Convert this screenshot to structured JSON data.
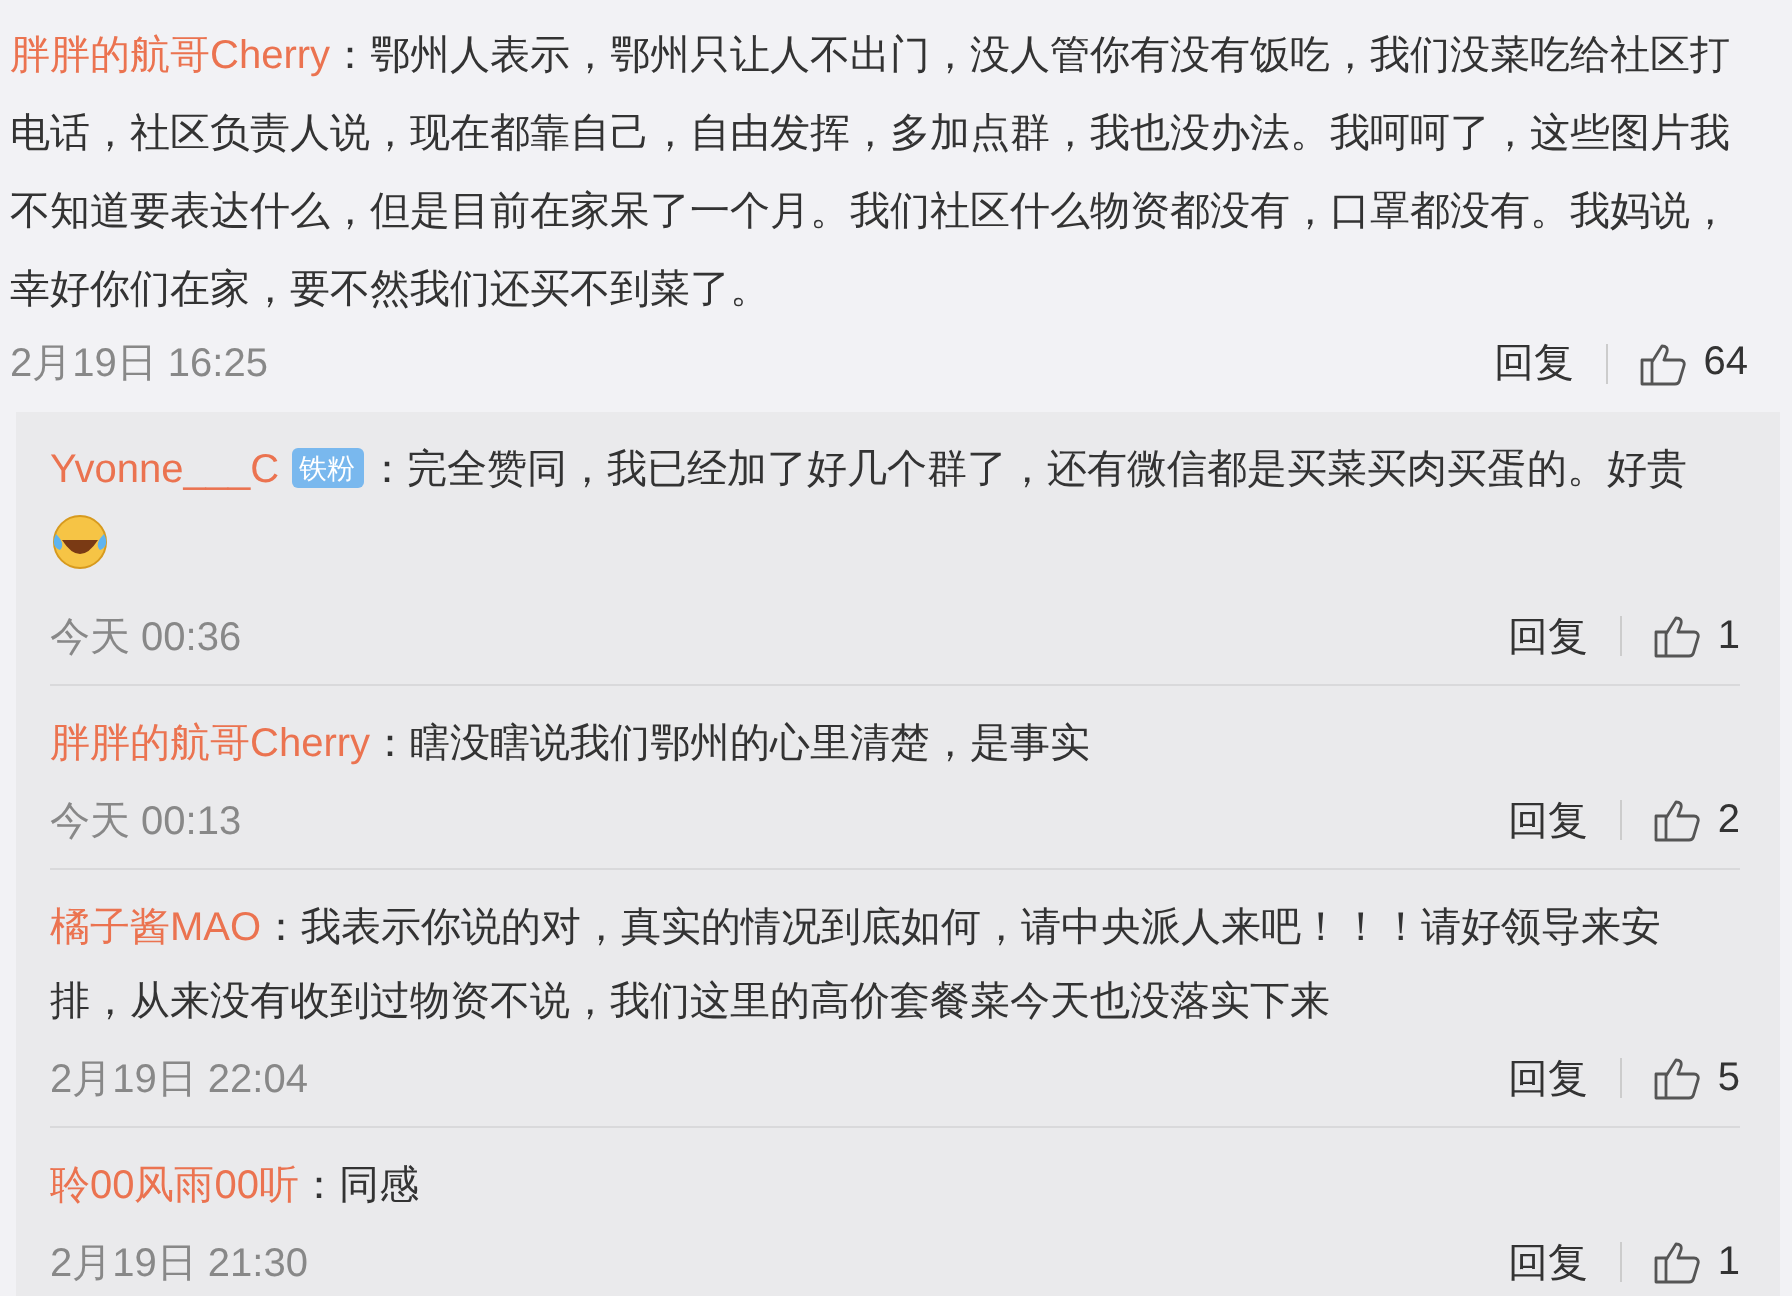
{
  "comment": {
    "author": "胖胖的航哥Cherry",
    "separator": "：",
    "text": "鄂州人表示，鄂州只让人不出门，没人管你有没有饭吃，我们没菜吃给社区打电话，社区负责人说，现在都靠自己，自由发挥，多加点群，我也没办法。我呵呵了，这些图片我不知道要表达什么，但是目前在家呆了一个月。我们社区什么物资都没有，口罩都没有。我妈说，幸好你们在家，要不然我们还买不到菜了。",
    "time": "2月19日 16:25",
    "reply_label": "回复",
    "likes": "64"
  },
  "replies": [
    {
      "author": "Yvonne___C",
      "badge": "铁粉",
      "separator": "：",
      "text": "完全赞同，我已经加了好几个群了，还有微信都是买菜买肉买蛋的。好贵",
      "emoji": true,
      "time": "今天 00:36",
      "reply_label": "回复",
      "likes": "1"
    },
    {
      "author": "胖胖的航哥Cherry",
      "separator": "：",
      "text": "瞎没瞎说我们鄂州的心里清楚，是事实",
      "time": "今天 00:13",
      "reply_label": "回复",
      "likes": "2"
    },
    {
      "author": "橘子酱MAO",
      "separator": "：",
      "text": "我表示你说的对，真实的情况到底如何，请中央派人来吧！！！请好领导来安排，从来没有收到过物资不说，我们这里的高价套餐菜今天也没落实下来",
      "time": "2月19日 22:04",
      "reply_label": "回复",
      "likes": "5"
    },
    {
      "author": "聆00风雨00听",
      "separator": "：",
      "text": "同感",
      "time": "2月19日 21:30",
      "reply_label": "回复",
      "likes": "1"
    }
  ]
}
